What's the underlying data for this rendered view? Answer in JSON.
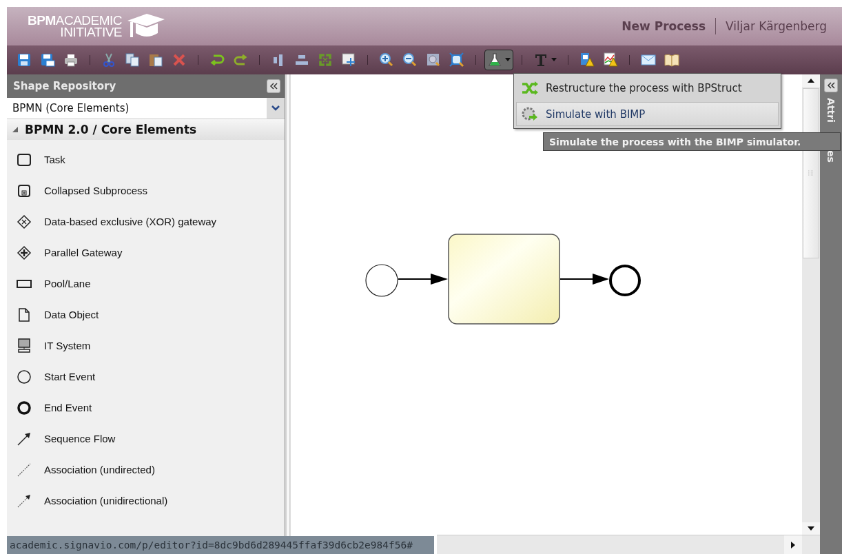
{
  "header": {
    "logo": {
      "strong": "BPM",
      "line1": "ACADEMIC",
      "line2": "INITIATIVE"
    },
    "document_title": "New Process",
    "user": "Viljar Kärgenberg"
  },
  "toolbar": {
    "simulation_menu": {
      "expanded": true
    },
    "text_menu": {
      "expanded": false
    }
  },
  "dropdown_menu": {
    "items": [
      {
        "label": "Restructure the process with BPStruct",
        "kind": "restructure",
        "selected": false
      },
      {
        "label": "Simulate with BIMP",
        "kind": "simulate",
        "selected": true
      }
    ]
  },
  "tooltip": "Simulate the process with the BIMP simulator.",
  "shape_repository": {
    "title": "Shape Repository",
    "stencil_set": "BPMN (Core Elements)",
    "group": {
      "label": "BPMN 2.0 / Core Elements",
      "expanded": true,
      "items": [
        {
          "label": "Task",
          "kind": "task"
        },
        {
          "label": "Collapsed Subprocess",
          "kind": "subprocess"
        },
        {
          "label": "Data-based exclusive (XOR) gateway",
          "kind": "xor"
        },
        {
          "label": "Parallel Gateway",
          "kind": "parallel"
        },
        {
          "label": "Pool/Lane",
          "kind": "pool"
        },
        {
          "label": "Data Object",
          "kind": "data"
        },
        {
          "label": "IT System",
          "kind": "it"
        },
        {
          "label": "Start Event",
          "kind": "start"
        },
        {
          "label": "End Event",
          "kind": "end"
        },
        {
          "label": "Sequence Flow",
          "kind": "sequence"
        },
        {
          "label": "Association (undirected)",
          "kind": "assoc"
        },
        {
          "label": "Association (unidirectional)",
          "kind": "assoc-dir"
        }
      ]
    }
  },
  "attributes_panel": {
    "title_parts": [
      "Attri",
      "es"
    ]
  },
  "status_bar": "academic.signavio.com/p/editor?id=8dc9bd6d289445ffaf39d6cb2e984f56#"
}
